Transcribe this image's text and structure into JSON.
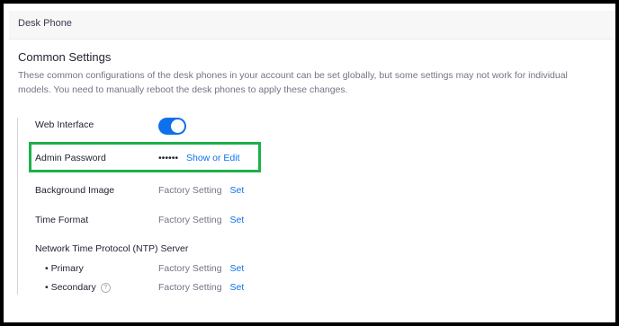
{
  "header": {
    "title": "Desk Phone"
  },
  "common": {
    "heading": "Common Settings",
    "description": "These common configurations of the desk phones in your account can be set globally, but some settings may not work for individual models. You need to manually reboot the desk phones to apply these changes."
  },
  "settings": {
    "web_interface": {
      "label": "Web Interface",
      "enabled": true
    },
    "admin_password": {
      "label": "Admin Password",
      "value": "••••••",
      "link": "Show or Edit"
    },
    "background_image": {
      "label": "Background Image",
      "value": "Factory Setting",
      "link": "Set"
    },
    "time_format": {
      "label": "Time Format",
      "value": "Factory Setting",
      "link": "Set"
    },
    "ntp": {
      "label": "Network Time Protocol (NTP) Server",
      "primary": {
        "label": "• Primary",
        "value": "Factory Setting",
        "link": "Set"
      },
      "secondary": {
        "label": "• Secondary",
        "value": "Factory Setting",
        "link": "Set",
        "help_icon": "help-icon"
      }
    }
  },
  "colors": {
    "accent": "#0e71eb",
    "highlight": "#1db04a"
  }
}
